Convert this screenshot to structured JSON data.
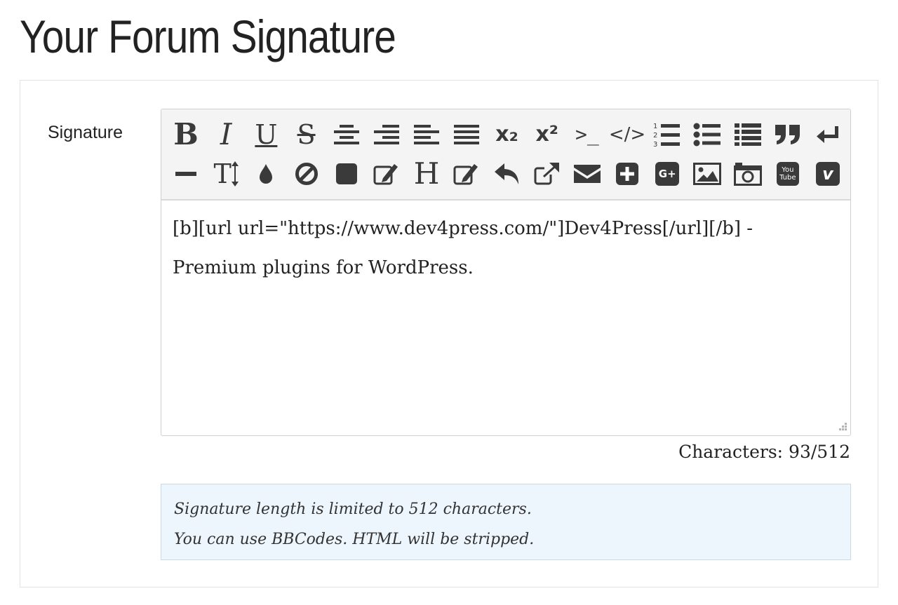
{
  "page": {
    "title": "Your Forum Signature"
  },
  "field": {
    "label": "Signature"
  },
  "toolbar": {
    "row1": [
      {
        "name": "bold",
        "icon": "bold-icon",
        "glyph": "B"
      },
      {
        "name": "italic",
        "icon": "italic-icon",
        "glyph": "I"
      },
      {
        "name": "underline",
        "icon": "underline-icon",
        "glyph": "U"
      },
      {
        "name": "strikethrough",
        "icon": "strikethrough-icon",
        "glyph": "S"
      },
      {
        "name": "align-center",
        "icon": "align-center-icon"
      },
      {
        "name": "align-right",
        "icon": "align-right-icon"
      },
      {
        "name": "align-left",
        "icon": "align-left-icon"
      },
      {
        "name": "justify",
        "icon": "justify-icon"
      },
      {
        "name": "subscript",
        "icon": "subscript-icon",
        "glyph": "x₂"
      },
      {
        "name": "superscript",
        "icon": "superscript-icon",
        "glyph": "x²"
      },
      {
        "name": "terminal",
        "icon": "terminal-icon",
        "glyph": ">_"
      },
      {
        "name": "code",
        "icon": "code-icon",
        "glyph": "</>"
      },
      {
        "name": "ordered-list",
        "icon": "ordered-list-icon"
      },
      {
        "name": "unordered-list",
        "icon": "unordered-list-icon"
      },
      {
        "name": "list",
        "icon": "list-icon"
      },
      {
        "name": "quote",
        "icon": "quote-icon"
      },
      {
        "name": "line-break",
        "icon": "line-break-icon"
      }
    ],
    "row2": [
      {
        "name": "horizontal-rule",
        "icon": "horizontal-rule-icon"
      },
      {
        "name": "font-size",
        "icon": "font-size-icon",
        "glyph": "T"
      },
      {
        "name": "color",
        "icon": "color-drop-icon"
      },
      {
        "name": "nobbc",
        "icon": "ban-icon"
      },
      {
        "name": "block",
        "icon": "square-icon"
      },
      {
        "name": "edit",
        "icon": "edit-icon"
      },
      {
        "name": "heading",
        "icon": "heading-icon",
        "glyph": "H"
      },
      {
        "name": "note",
        "icon": "note-edit-icon"
      },
      {
        "name": "reply",
        "icon": "reply-icon"
      },
      {
        "name": "external-link",
        "icon": "external-link-icon"
      },
      {
        "name": "email",
        "icon": "envelope-icon"
      },
      {
        "name": "add",
        "icon": "plus-square-icon"
      },
      {
        "name": "google-plus",
        "icon": "google-plus-icon",
        "glyph": "G+"
      },
      {
        "name": "image",
        "icon": "image-icon"
      },
      {
        "name": "webshot",
        "icon": "camera-icon"
      },
      {
        "name": "youtube",
        "icon": "youtube-icon",
        "glyph": "You Tube"
      },
      {
        "name": "vimeo",
        "icon": "vimeo-icon",
        "glyph": "v"
      }
    ]
  },
  "editor": {
    "value": "[b][url url=\"https://www.dev4press.com/\"]Dev4Press[/url][/b] - Premium plugins for WordPress."
  },
  "counter": {
    "text": "Characters: 93/512"
  },
  "notice": {
    "line1": "Signature length is limited to 512 characters.",
    "line2": "You can use BBCodes. HTML will be stripped."
  },
  "colors": {
    "toolbar_bg": "#f4f4f4",
    "icon": "#3a3a3a",
    "notice_bg": "#eef6fd",
    "notice_border": "#c9dbe8"
  }
}
